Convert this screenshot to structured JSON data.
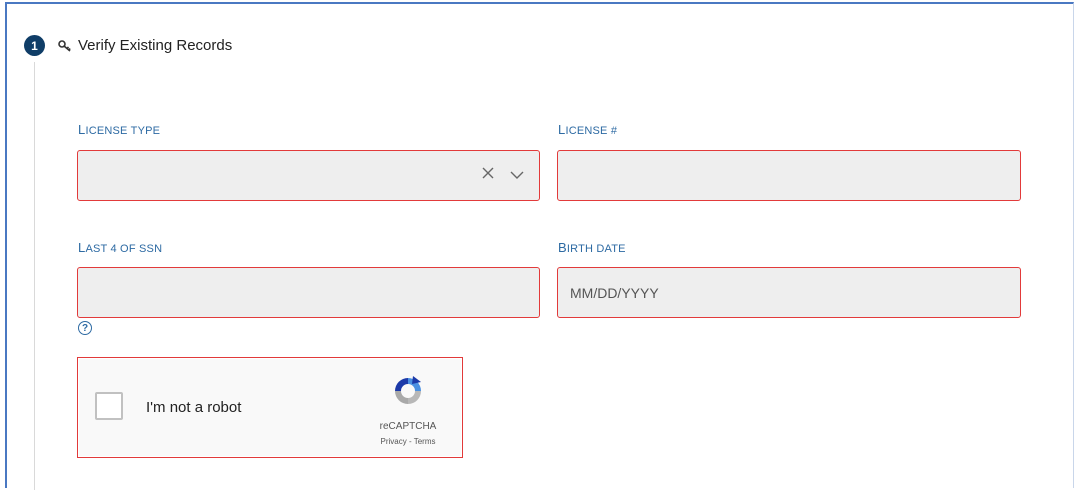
{
  "step": {
    "number": "1",
    "title": "Verify Existing Records"
  },
  "form": {
    "license_type": {
      "label_first": "L",
      "label_rest": "icense Type",
      "value": ""
    },
    "license_number": {
      "label_first": "L",
      "label_rest": "icense #",
      "value": ""
    },
    "ssn_last4": {
      "label_first": "L",
      "label_rest": "ast 4 of SSN",
      "value": ""
    },
    "birth_date": {
      "label_first": "B",
      "label_rest": "irth Date",
      "placeholder": "MM/DD/YYYY",
      "value": ""
    },
    "help_glyph": "?"
  },
  "captcha": {
    "label": "I'm not a robot",
    "brand": "reCAPTCHA",
    "privacy": "Privacy",
    "separator": " - ",
    "terms": "Terms"
  },
  "colors": {
    "step_circle": "#0f3d67",
    "label": "#2d6aa3",
    "error_border": "#e23a3a",
    "field_bg": "#eeeeee"
  },
  "icons": {
    "title": "key-icon",
    "select_clear": "close-icon",
    "select_toggle": "chevron-down-icon",
    "help": "question-circle-icon",
    "captcha": "recaptcha-logo-icon"
  }
}
